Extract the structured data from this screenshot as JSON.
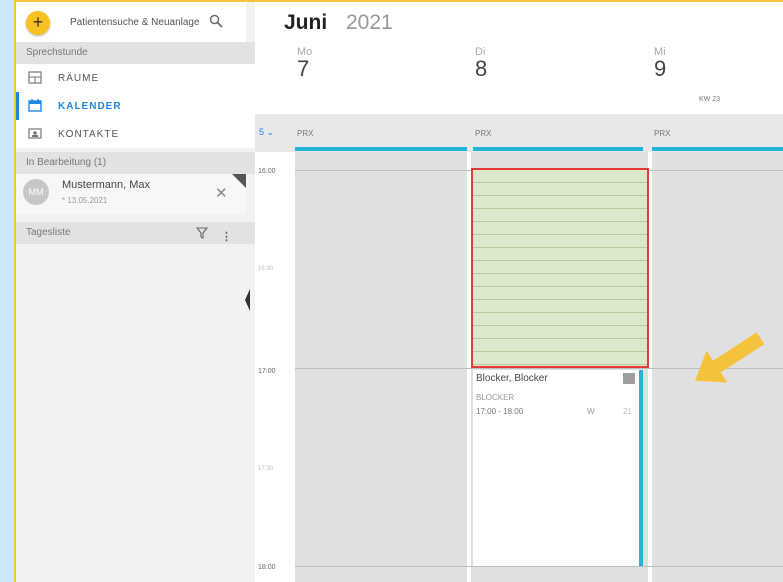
{
  "sidebar": {
    "add_label": "+",
    "search_placeholder": "Patientensuche & Neuanlage",
    "section_sprechstunde": "Sprechstunde",
    "nav": [
      {
        "label": "RÄUME",
        "icon": "rooms-icon",
        "active": false
      },
      {
        "label": "KALENDER",
        "icon": "calendar-icon",
        "active": true
      },
      {
        "label": "KONTAKTE",
        "icon": "contacts-icon",
        "active": false
      }
    ],
    "in_progress_header": "In Bearbeitung (1)",
    "patient": {
      "initials": "MM",
      "name": "Mustermann, Max",
      "dob": "* 13.05.2021"
    },
    "tagesliste": "Tagesliste"
  },
  "calendar": {
    "month": "Juni",
    "year": "2021",
    "days": [
      {
        "name": "Mo",
        "num": "7"
      },
      {
        "name": "Di",
        "num": "8"
      },
      {
        "name": "Mi",
        "num": "9"
      }
    ],
    "kw": "KW 23",
    "resource_count": "5 ⌄",
    "resource_label": "PRX",
    "times": [
      "16:00",
      "16:30",
      "17:00",
      "17:30",
      "18:00"
    ],
    "blocker": {
      "title": "Blocker, Blocker",
      "sub": "BLOCKER",
      "time": "17:00 - 18:00",
      "w": "W",
      "num": "21"
    }
  },
  "colors": {
    "accent": "#f7c21f",
    "active": "#1e88e5",
    "resource_bar": "#22b5d6",
    "selection_border": "#e53935",
    "selection_fill": "#dbe8cb",
    "frame": "#f5c33b"
  }
}
